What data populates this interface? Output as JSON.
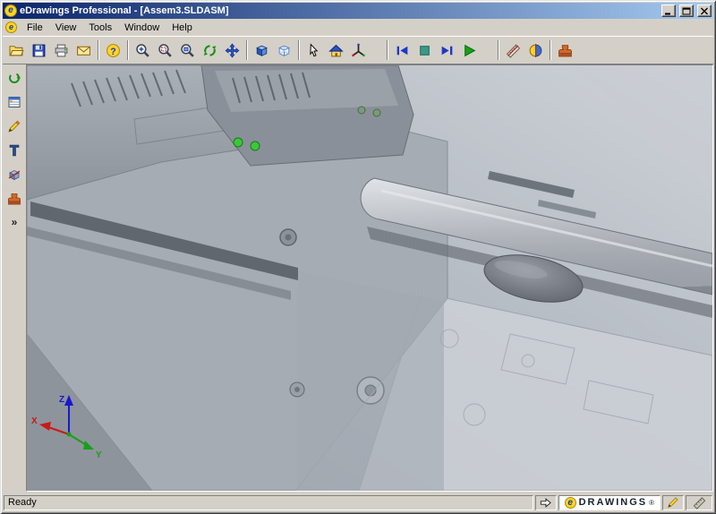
{
  "window": {
    "title": "eDrawings Professional - [Assem3.SLDASM]",
    "controls": [
      "minimize",
      "maximize",
      "close"
    ]
  },
  "menubar": {
    "items": [
      {
        "label": "File"
      },
      {
        "label": "View"
      },
      {
        "label": "Tools"
      },
      {
        "label": "Window"
      },
      {
        "label": "Help"
      }
    ]
  },
  "toolbar": {
    "buttons": [
      "open",
      "save",
      "print",
      "send-email",
      "help",
      "zoom-in",
      "zoom-to-area",
      "zoom-to-fit",
      "rotate-view",
      "pan",
      "shaded-view",
      "wireframe-view",
      "select",
      "home-view",
      "3d-pointer",
      "previous-view",
      "stop-animation",
      "next-view",
      "play-animation",
      "measure",
      "cross-section",
      "stamp"
    ]
  },
  "sidebar": {
    "buttons": [
      "animate",
      "components",
      "markup",
      "measure",
      "cross-section",
      "stamp"
    ],
    "expander": "»"
  },
  "viewport": {
    "triad": {
      "x": "X",
      "y": "Y",
      "z": "Z"
    }
  },
  "statusbar": {
    "ready": "Ready",
    "branding": {
      "logo_letter": "e",
      "text": "DRAWINGS",
      "registered": "®"
    }
  },
  "icons": {
    "help_glyph": "?",
    "logo_letter": "e"
  },
  "colors": {
    "titlebar_start": "#0a246a",
    "titlebar_end": "#a6caf0",
    "chrome": "#d4d0c8",
    "led_green": "#3ac83a"
  }
}
